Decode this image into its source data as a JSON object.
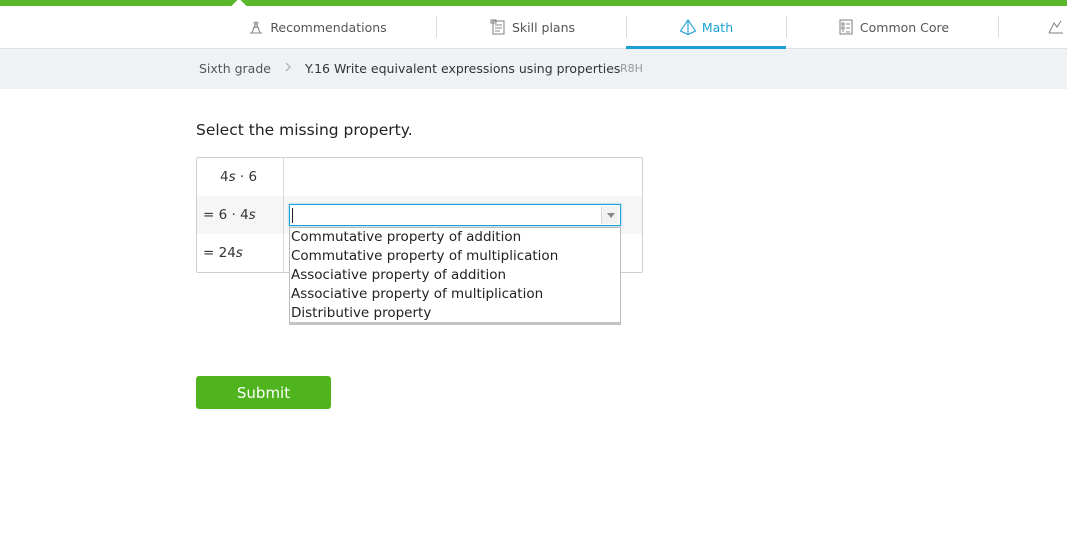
{
  "nav": {
    "tabs": [
      {
        "label": "Recommendations",
        "icon": "recommendations-icon"
      },
      {
        "label": "Skill plans",
        "icon": "skill-plans-icon"
      },
      {
        "label": "Math",
        "icon": "math-pyramid-icon",
        "active": true
      },
      {
        "label": "Common Core",
        "icon": "common-core-icon"
      }
    ]
  },
  "breadcrumb": {
    "grade": "Sixth grade",
    "separator": ">",
    "skill": "Y.16 Write equivalent expressions using properties",
    "code": "R8H"
  },
  "question": {
    "prompt": "Select the missing property."
  },
  "expressions": [
    {
      "prefix": "",
      "a": "4",
      "var": "s",
      "rest": " · 6"
    },
    {
      "prefix": "= ",
      "a": "6 · 4",
      "var": "s",
      "rest": ""
    },
    {
      "prefix": "= ",
      "a": "24",
      "var": "s",
      "rest": ""
    }
  ],
  "select": {
    "value": "",
    "options": [
      "Commutative property of addition",
      "Commutative property of multiplication",
      "Associative property of addition",
      "Associative property of multiplication",
      "Distributive property"
    ]
  },
  "submit": {
    "label": "Submit"
  },
  "colors": {
    "brand_green": "#5bb82d",
    "accent_blue": "#1b9fd7",
    "submit_green": "#4fb41e"
  }
}
